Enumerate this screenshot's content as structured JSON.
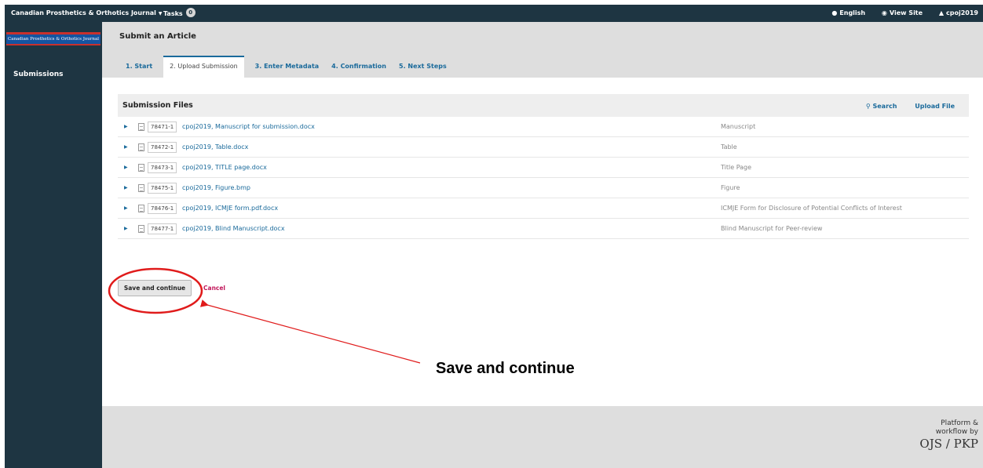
{
  "topbar": {
    "journal": "Canadian Prosthetics & Orthotics Journal",
    "tasks_label": "Tasks",
    "tasks_count": "0",
    "language": "English",
    "view_site": "View Site",
    "user": "cpoj2019"
  },
  "sidebar": {
    "logo_text": "Canadian Prosthetics & Orthotics Journal",
    "items": [
      {
        "label": "Submissions"
      }
    ]
  },
  "header": {
    "title": "Submit an Article",
    "tabs": [
      {
        "label": "1. Start"
      },
      {
        "label": "2. Upload Submission"
      },
      {
        "label": "3. Enter Metadata"
      },
      {
        "label": "4. Confirmation"
      },
      {
        "label": "5. Next Steps"
      }
    ]
  },
  "files": {
    "title": "Submission Files",
    "search_label": "Search",
    "upload_label": "Upload File",
    "rows": [
      {
        "id": "78471-1",
        "name": "cpoj2019, Manuscript for submission.docx",
        "type": "Manuscript"
      },
      {
        "id": "78472-1",
        "name": "cpoj2019, Table.docx",
        "type": "Table"
      },
      {
        "id": "78473-1",
        "name": "cpoj2019, TITLE page.docx",
        "type": "Title Page"
      },
      {
        "id": "78475-1",
        "name": "cpoj2019, Figure.bmp",
        "type": "Figure"
      },
      {
        "id": "78476-1",
        "name": "cpoj2019, ICMJE form.pdf.docx",
        "type": "ICMJE Form for Disclosure of Potential Conflicts of Interest"
      },
      {
        "id": "78477-1",
        "name": "cpoj2019, Blind Manuscript.docx",
        "type": "Blind Manuscript for Peer-review"
      }
    ]
  },
  "actions": {
    "save_label": "Save and continue",
    "cancel_label": "Cancel"
  },
  "annotation": {
    "label": "Save and continue",
    "color": "#e01b1b"
  },
  "footer": {
    "line1": "Platform &",
    "line2": "workflow by",
    "brand": "OJS / PKP"
  },
  "colors": {
    "nav_dark": "#1e3542",
    "link_blue": "#1a6a9b",
    "cancel_pink": "#c2185b"
  }
}
